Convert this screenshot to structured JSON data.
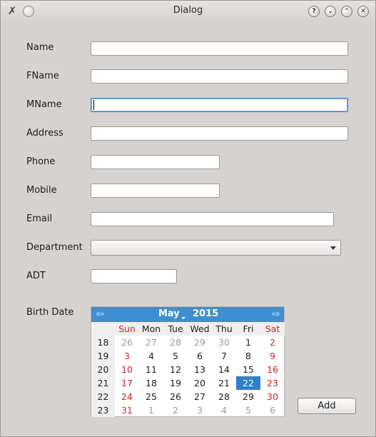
{
  "window": {
    "title": "Dialog",
    "icons": [
      "app-tools-icon",
      "sticky-pin-icon",
      "help-icon",
      "minimize-icon",
      "maximize-icon",
      "close-icon"
    ]
  },
  "form": {
    "name_label": "Name",
    "fname_label": "FName",
    "mname_label": "MName",
    "address_label": "Address",
    "phone_label": "Phone",
    "mobile_label": "Mobile",
    "email_label": "Email",
    "department_label": "Department",
    "adt_label": "ADT",
    "birth_date_label": "Birth Date",
    "name_value": "",
    "fname_value": "",
    "mname_value": "",
    "address_value": "",
    "phone_value": "",
    "mobile_value": "",
    "email_value": "",
    "department_value": "",
    "adt_value": ""
  },
  "calendar": {
    "month": "May",
    "year": "2015",
    "day_headers": [
      "Sun",
      "Mon",
      "Tue",
      "Wed",
      "Thu",
      "Fri",
      "Sat"
    ],
    "selected_day": "22",
    "weeks": [
      {
        "week": "18",
        "days": [
          "26",
          "27",
          "28",
          "29",
          "30",
          "1",
          "2"
        ],
        "other": [
          true,
          true,
          true,
          true,
          true,
          false,
          false
        ]
      },
      {
        "week": "19",
        "days": [
          "3",
          "4",
          "5",
          "6",
          "7",
          "8",
          "9"
        ],
        "other": [
          false,
          false,
          false,
          false,
          false,
          false,
          false
        ]
      },
      {
        "week": "20",
        "days": [
          "10",
          "11",
          "12",
          "13",
          "14",
          "15",
          "16"
        ],
        "other": [
          false,
          false,
          false,
          false,
          false,
          false,
          false
        ]
      },
      {
        "week": "21",
        "days": [
          "17",
          "18",
          "19",
          "20",
          "21",
          "22",
          "23"
        ],
        "other": [
          false,
          false,
          false,
          false,
          false,
          false,
          false
        ]
      },
      {
        "week": "22",
        "days": [
          "24",
          "25",
          "26",
          "27",
          "28",
          "29",
          "30"
        ],
        "other": [
          false,
          false,
          false,
          false,
          false,
          false,
          false
        ]
      },
      {
        "week": "23",
        "days": [
          "31",
          "1",
          "2",
          "3",
          "4",
          "5",
          "6"
        ],
        "other": [
          false,
          true,
          true,
          true,
          true,
          true,
          true
        ]
      }
    ],
    "colors": {
      "header": "#3d8fd1",
      "selected": "#2f7fca",
      "weekend": "#d81e1e",
      "other_month": "#9a9a9a"
    }
  },
  "buttons": {
    "add_label": "Add",
    "help_glyph": "?",
    "minimize_glyph": "⌄",
    "maximize_glyph": "⌃",
    "close_glyph": "✕"
  }
}
